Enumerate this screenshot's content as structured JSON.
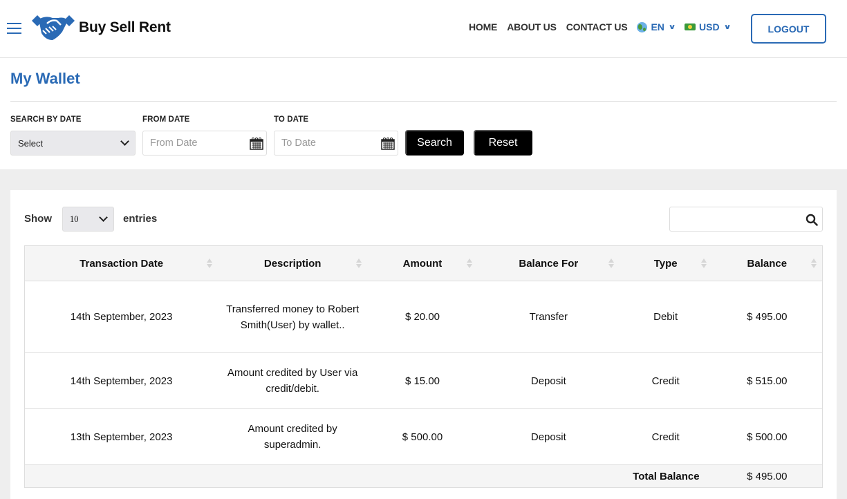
{
  "header": {
    "brand": "Buy Sell Rent",
    "nav": [
      "HOME",
      "ABOUT US",
      "CONTACT US"
    ],
    "language": "EN",
    "currency": "USD",
    "logout_label": "LOGOUT"
  },
  "page": {
    "title": "My Wallet"
  },
  "filters": {
    "search_by_date_label": "SEARCH BY DATE",
    "search_by_date_value": "Select",
    "from_date_label": "FROM DATE",
    "from_date_placeholder": "From Date",
    "to_date_label": "TO DATE",
    "to_date_placeholder": "To Date",
    "search_button": "Search",
    "reset_button": "Reset"
  },
  "table_controls": {
    "show_label": "Show",
    "entries_value": "10",
    "entries_label": "entries",
    "search_value": ""
  },
  "table": {
    "columns": [
      "Transaction Date",
      "Description",
      "Amount",
      "Balance For",
      "Type",
      "Balance"
    ],
    "rows": [
      {
        "date": "14th September, 2023",
        "description": "Transferred money to Robert Smith(User) by wallet..",
        "amount": "$ 20.00",
        "balance_for": "Transfer",
        "type": "Debit",
        "balance": "$ 495.00"
      },
      {
        "date": "14th September, 2023",
        "description": "Amount credited by User via credit/debit.",
        "amount": "$ 15.00",
        "balance_for": "Deposit",
        "type": "Credit",
        "balance": "$ 515.00"
      },
      {
        "date": "13th September, 2023",
        "description": "Amount credited by superadmin.",
        "amount": "$ 500.00",
        "balance_for": "Deposit",
        "type": "Credit",
        "balance": "$ 500.00"
      }
    ],
    "total_label": "Total Balance",
    "total_value": "$ 495.00"
  },
  "colors": {
    "brand_blue": "#2a6ab5",
    "button_black": "#000000",
    "page_grey": "#eeeeee"
  }
}
